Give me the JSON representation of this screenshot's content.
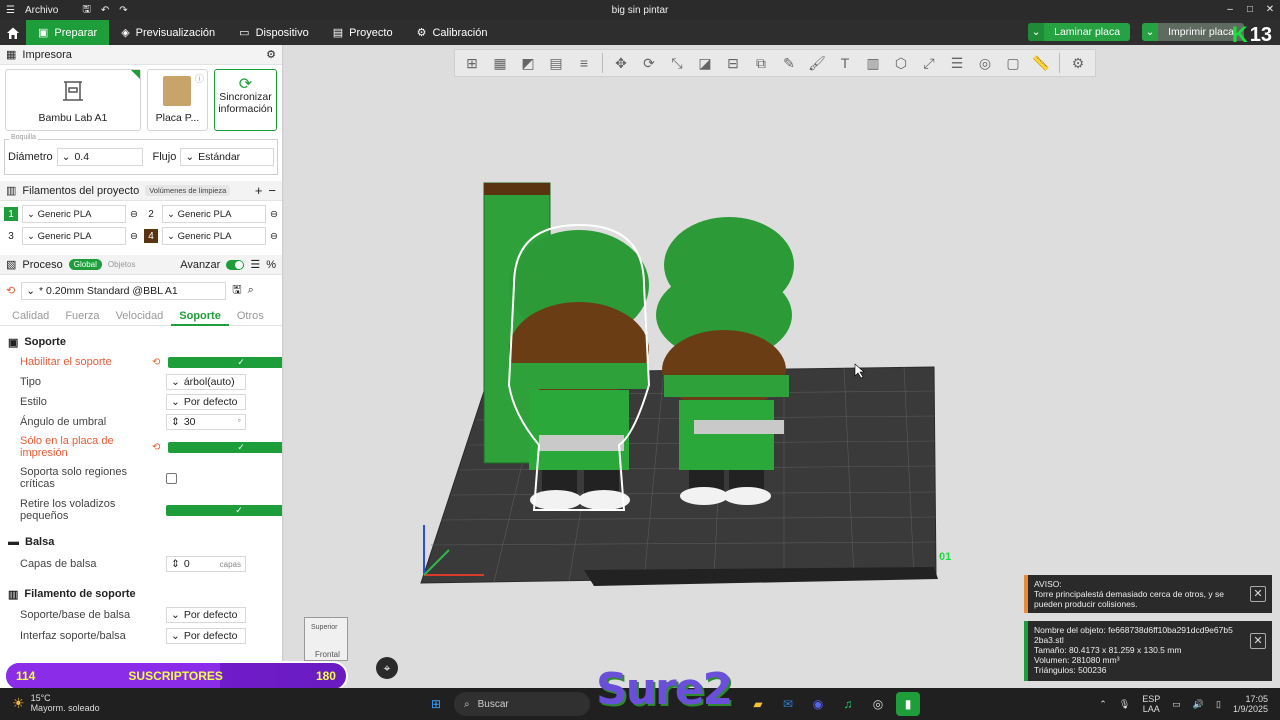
{
  "titlebar": {
    "menu": "Archivo",
    "title": "big sin pintar"
  },
  "nav": {
    "tabs": [
      {
        "label": "Preparar"
      },
      {
        "label": "Previsualización"
      },
      {
        "label": "Dispositivo"
      },
      {
        "label": "Proyecto"
      },
      {
        "label": "Calibración"
      }
    ],
    "slice_label": "Laminar placa",
    "print_label": "Imprimir placa",
    "brand_number": "13"
  },
  "printer": {
    "section": "Impresora",
    "model": "Bambu Lab A1",
    "plate": "Placa P...",
    "sync_line1": "Sincronizar",
    "sync_line2": "información",
    "group_label": "Boquilla",
    "diameter_label": "Diámetro",
    "diameter_value": "0.4",
    "flow_label": "Flujo",
    "flow_value": "Estándar"
  },
  "filaments": {
    "section": "Filamentos del proyecto",
    "purge_label": "Volúmenes de limpieza",
    "items": [
      {
        "num": "1",
        "name": "Generic PLA",
        "color": "#1e9e3a"
      },
      {
        "num": "2",
        "name": "Generic PLA",
        "color": "#ffffff"
      },
      {
        "num": "3",
        "name": "Generic PLA",
        "color": "#ffffff"
      },
      {
        "num": "4",
        "name": "Generic PLA",
        "color": "#5a3410"
      }
    ]
  },
  "process": {
    "section": "Proceso",
    "badge_global": "Global",
    "badge_objects": "Objetos",
    "advanced_label": "Avanzar",
    "profile": "* 0.20mm Standard @BBL A1",
    "tabs": [
      "Calidad",
      "Fuerza",
      "Velocidad",
      "Soporte",
      "Otros"
    ],
    "active_tab": "Soporte"
  },
  "support": {
    "group": "Soporte",
    "enable_label": "Habilitar el soporte",
    "type_label": "Tipo",
    "type_value": "árbol(auto)",
    "style_label": "Estilo",
    "style_value": "Por defecto",
    "angle_label": "Ángulo de umbral",
    "angle_value": "30",
    "angle_unit": "°",
    "buildplate_line1": "Sólo en la placa de",
    "buildplate_line2": "impresión",
    "critical_line1": "Soporta solo regiones",
    "critical_line2": "críticas",
    "overhang_line1": "Retire los voladizos",
    "overhang_line2": "pequeños"
  },
  "raft": {
    "group": "Balsa",
    "layers_label": "Capas de balsa",
    "layers_value": "0",
    "layers_unit": "capas"
  },
  "support_filament": {
    "group": "Filamento de soporte",
    "base_label": "Soporte/base de balsa",
    "base_value": "Por defecto",
    "interface_label": "Interfaz soporte/balsa",
    "interface_value": "Por defecto"
  },
  "viewport": {
    "view_top": "Superior",
    "view_front": "Frontal",
    "plate_number": "01"
  },
  "warning": {
    "title": "AVISO:",
    "line1": "Torre principalestá demasiado cerca de otros, y se",
    "line2": "pueden producir colisiones."
  },
  "object_info": {
    "name_line1": "Nombre del objeto: fe668738d6ff10ba291dcd9e67b5",
    "name_line2": "2ba3.stl",
    "size": "Tamaño: 80.4173 x 81.259 x 130.5 mm",
    "volume": "Volumen: 281080 mm³",
    "triangles": "Triángulos: 500236"
  },
  "overlay": {
    "subs_current": "114",
    "subs_label": "SUSCRIPTORES",
    "subs_goal": "180",
    "subs_progress": 0.63,
    "watermark": "Sure2"
  },
  "taskbar": {
    "temp": "15°C",
    "weather": "Mayorm. soleado",
    "search": "Buscar",
    "lang1": "ESP",
    "lang2": "LAA",
    "time": "17:05",
    "date": "1/9/2025"
  }
}
